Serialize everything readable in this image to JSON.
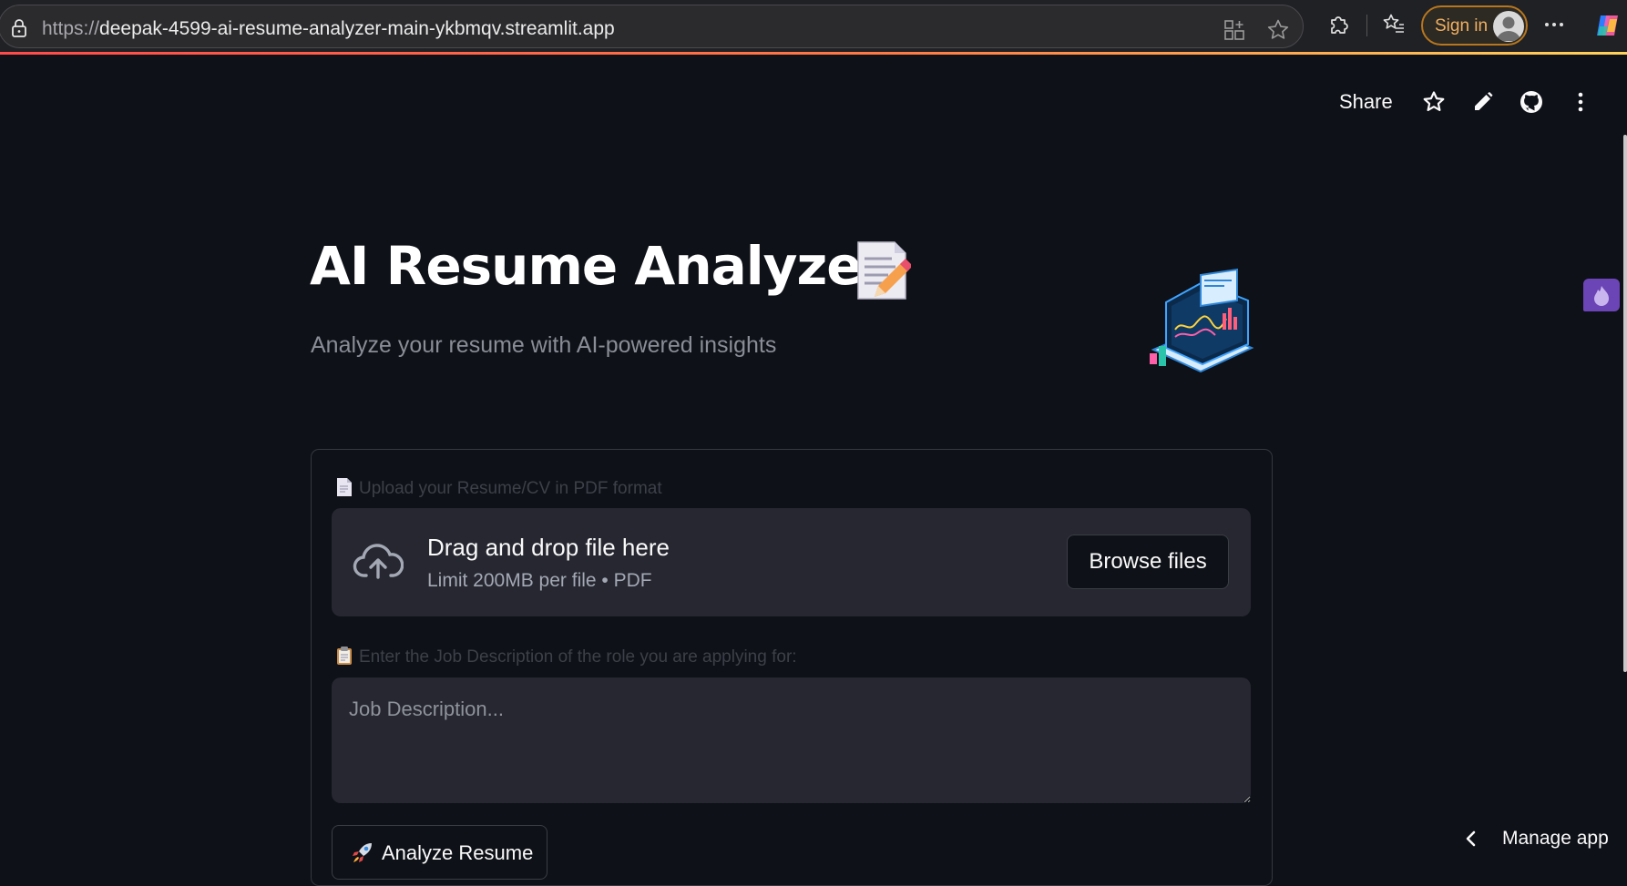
{
  "browser": {
    "url_scheme": "https://",
    "url_host": "deepak-4599-ai-resume-analyzer-main-ykbmqv.streamlit.app",
    "signin_label": "Sign in"
  },
  "header": {
    "share_label": "Share"
  },
  "hero": {
    "title": "AI Resume Analyzer",
    "subtitle": "Analyze your resume with AI-powered insights"
  },
  "upload": {
    "label": "Upload your Resume/CV in PDF format",
    "drop_title": "Drag and drop file here",
    "drop_limit": "Limit 200MB per file • PDF",
    "browse_label": "Browse files"
  },
  "job_description": {
    "label": "Enter the Job Description of the role you are applying for:",
    "placeholder": "Job Description...",
    "value": ""
  },
  "analyze": {
    "label": "Analyze Resume"
  },
  "footer": {
    "manage_app_label": "Manage app"
  },
  "colors": {
    "background": "#0e1117",
    "input_background": "#262730",
    "accent": "#ff4b4b",
    "signin_accent": "#f0b062"
  }
}
